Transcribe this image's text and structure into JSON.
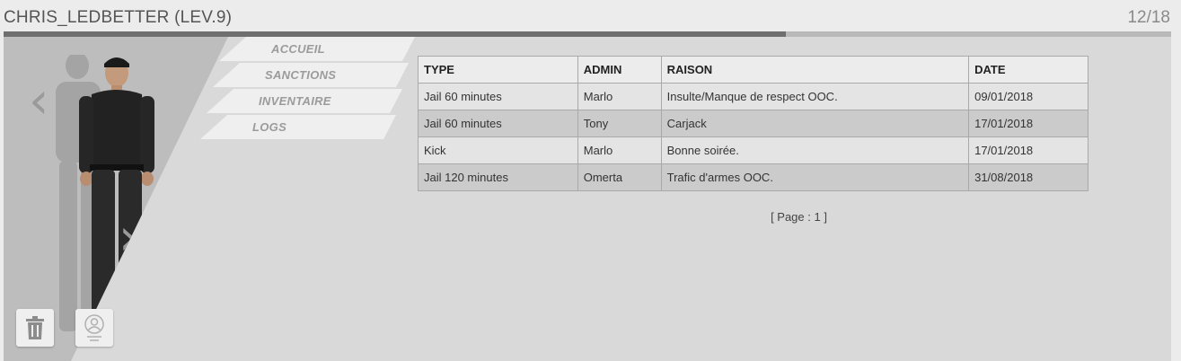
{
  "header": {
    "title": "CHRIS_LEDBETTER (LEV.9)",
    "counter": "12/18",
    "progress": 0.67
  },
  "menu": [
    {
      "label": "ACCUEIL"
    },
    {
      "label": "SANCTIONS"
    },
    {
      "label": "INVENTAIRE"
    },
    {
      "label": "LOGS"
    }
  ],
  "table": {
    "headers": [
      "TYPE",
      "ADMIN",
      "RAISON",
      "DATE"
    ],
    "rows": [
      [
        "Jail 60 minutes",
        "Marlo",
        "Insulte/Manque de respect OOC.",
        "09/01/2018"
      ],
      [
        "Jail 60 minutes",
        "Tony",
        "Carjack",
        "17/01/2018"
      ],
      [
        "Kick",
        "Marlo",
        "Bonne soirée.",
        "17/01/2018"
      ],
      [
        "Jail 120 minutes",
        "Omerta",
        "Trafic d'armes OOC.",
        "31/08/2018"
      ]
    ]
  },
  "pager": "[ Page : 1 ]",
  "icons": {
    "prev": "chevron-left-icon",
    "next": "chevron-right-icon",
    "delete": "trash-icon",
    "profile": "user-profile-icon"
  },
  "colors": {
    "progress_fill": "#6f6f6f",
    "progress_track": "#b9b9b9",
    "panel_bg": "#d9d9d9"
  }
}
